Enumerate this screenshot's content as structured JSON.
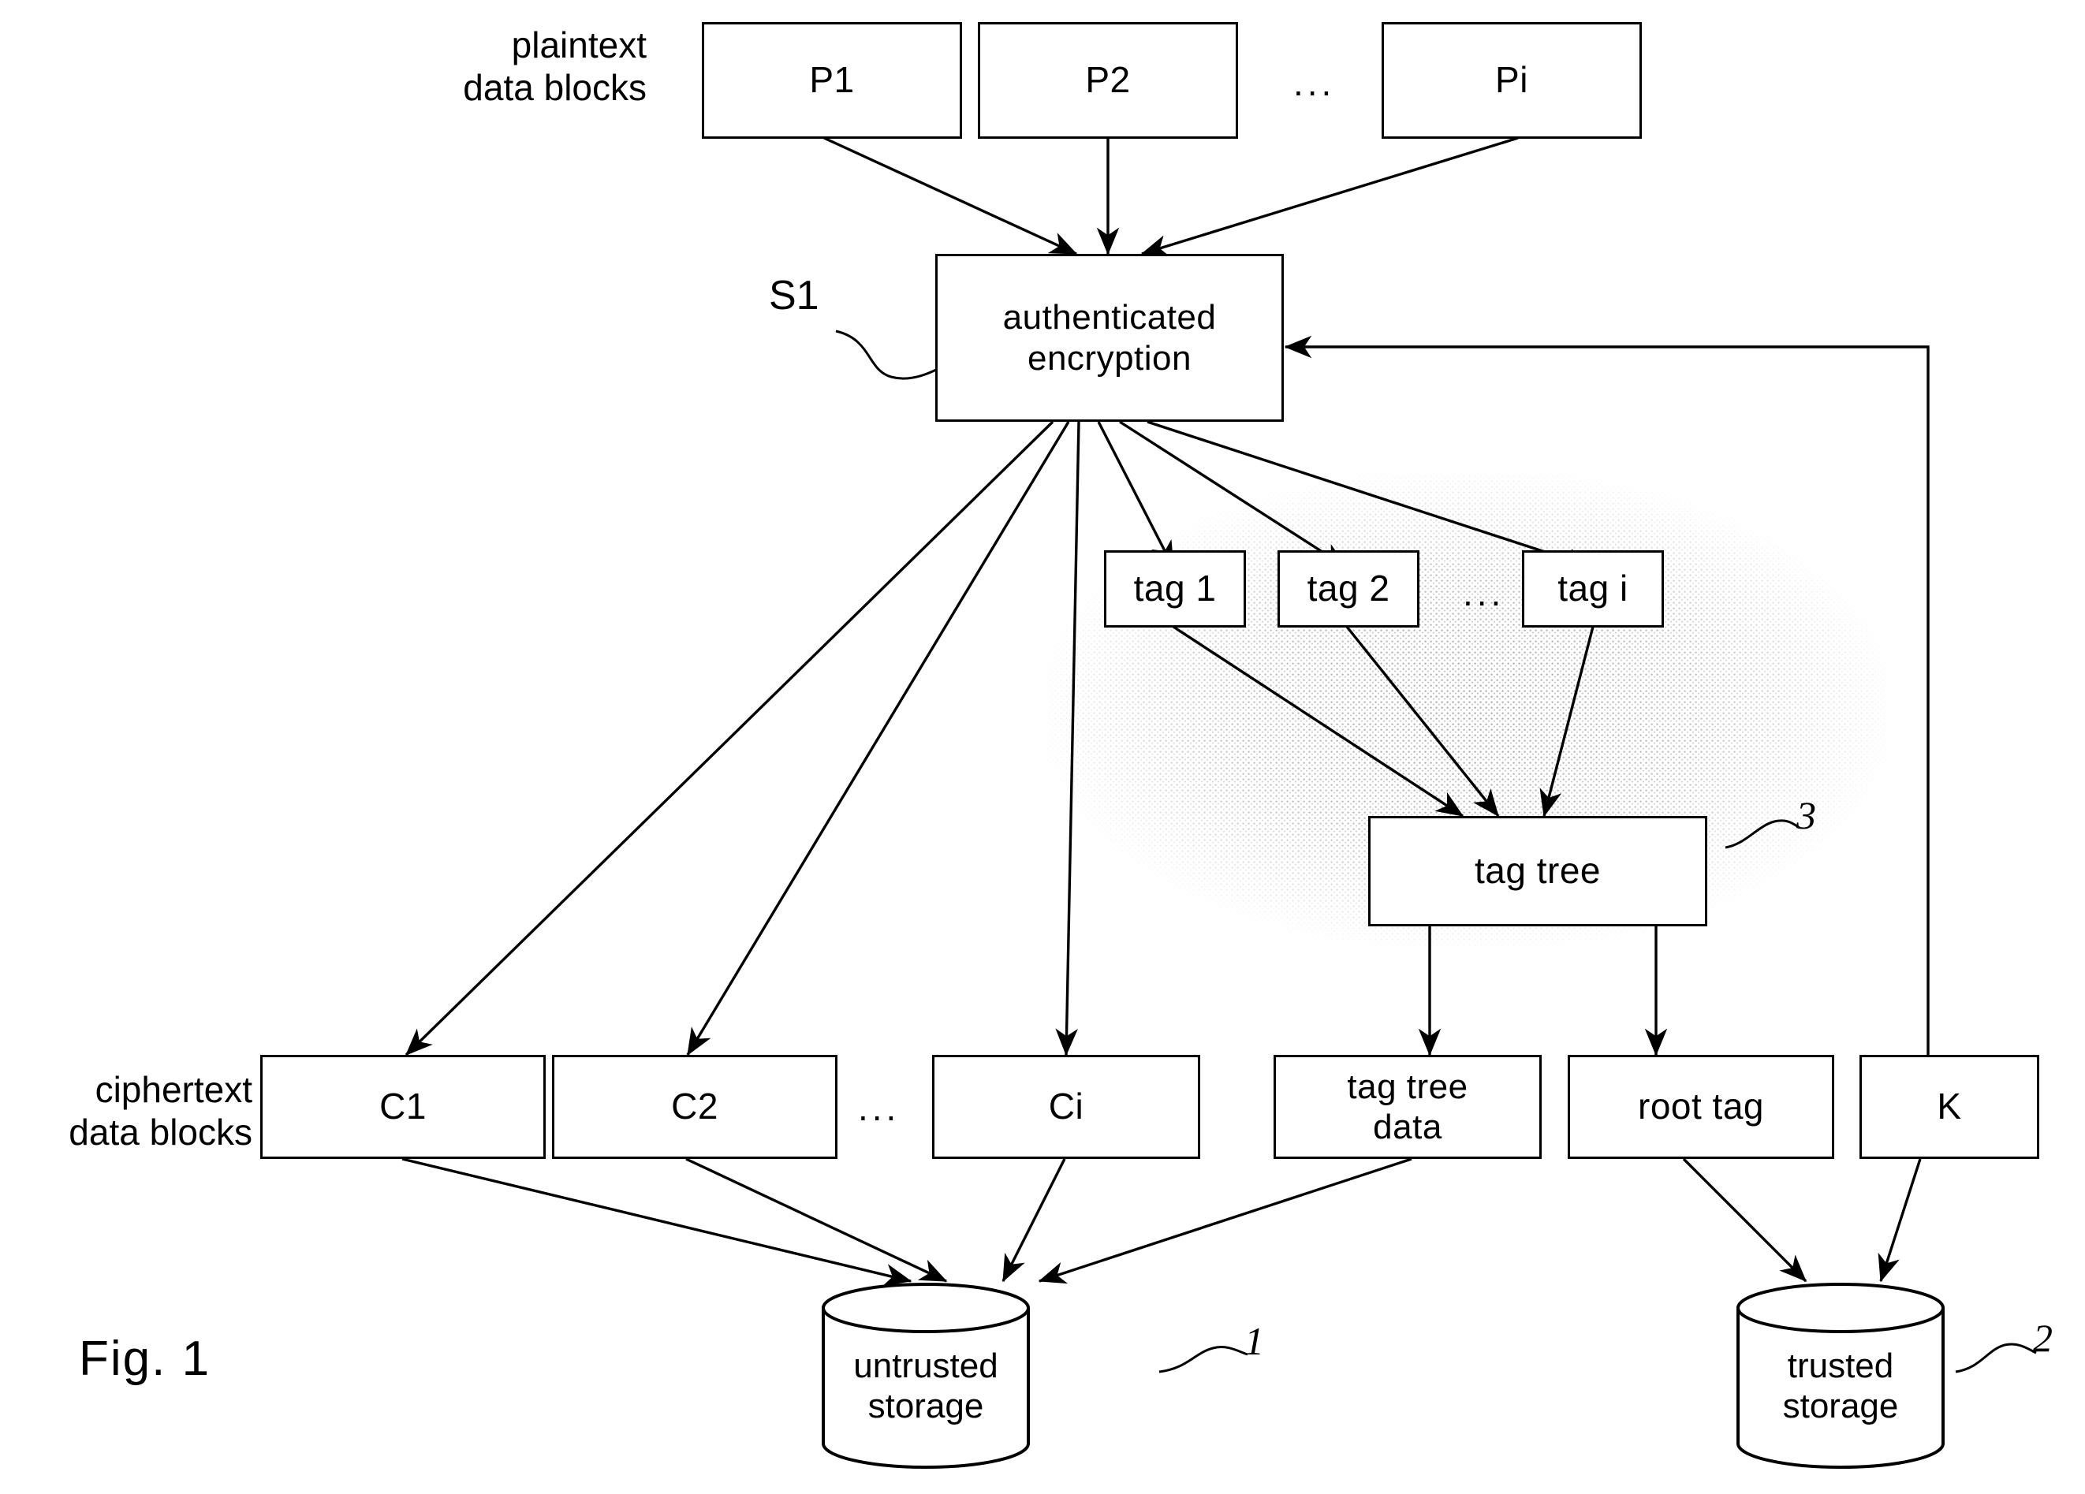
{
  "figure": {
    "caption": "Fig. 1",
    "title_hint": "authenticated encryption data flow to trusted and untrusted storage"
  },
  "labels": {
    "plaintext": "plaintext\ndata blocks",
    "ciphertext": "ciphertext\ndata blocks",
    "step_s1": "S1",
    "ref_untrusted": "1",
    "ref_trusted": "2",
    "ref_tagtree": "3",
    "ellipsis": "..."
  },
  "plaintext_blocks": [
    {
      "id": "p1",
      "label": "P1"
    },
    {
      "id": "p2",
      "label": "P2"
    },
    {
      "id": "pi",
      "label": "Pi"
    }
  ],
  "process": {
    "label": "authenticated\nencryption",
    "line1": "authenticated",
    "line2": "encryption"
  },
  "tags": [
    {
      "id": "tag1",
      "label": "tag 1"
    },
    {
      "id": "tag2",
      "label": "tag 2"
    },
    {
      "id": "tagi",
      "label": "tag i"
    }
  ],
  "tag_tree": {
    "label": "tag tree"
  },
  "ciphertext_blocks": [
    {
      "id": "c1",
      "label": "C1"
    },
    {
      "id": "c2",
      "label": "C2"
    },
    {
      "id": "ci",
      "label": "Ci"
    }
  ],
  "outputs": [
    {
      "id": "tagtreedata",
      "label": "tag tree\ndata",
      "line1": "tag tree",
      "line2": "data"
    },
    {
      "id": "roottag",
      "label": "root tag"
    },
    {
      "id": "key",
      "label": "K"
    }
  ],
  "storage": [
    {
      "id": "untrusted",
      "label": "untrusted\nstorage",
      "line1": "untrusted",
      "line2": "storage",
      "ref": "1"
    },
    {
      "id": "trusted",
      "label": "trusted\nstorage",
      "line1": "trusted",
      "line2": "storage",
      "ref": "2"
    }
  ],
  "colors": {
    "stroke": "#000000",
    "background": "#ffffff",
    "speckle": "#b8b8b8"
  }
}
